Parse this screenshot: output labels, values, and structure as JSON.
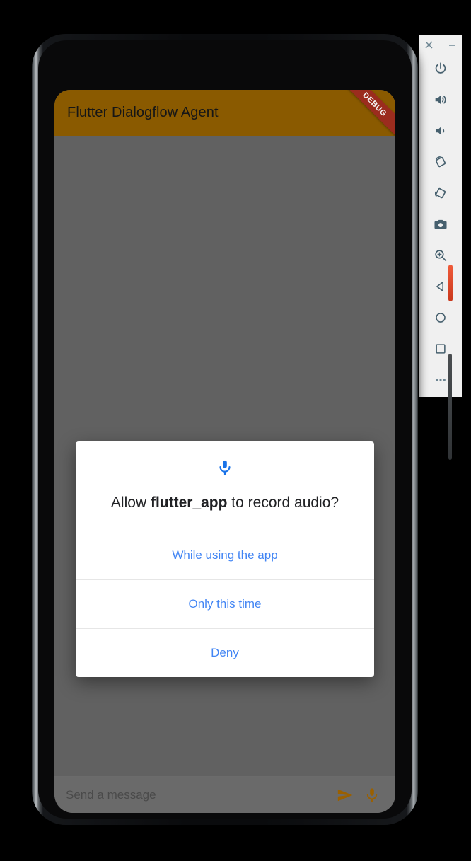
{
  "emulator_toolbar": {
    "window_controls": [
      {
        "name": "close",
        "glyph": "✕"
      },
      {
        "name": "minimize",
        "glyph": "–"
      }
    ],
    "buttons": [
      {
        "name": "power",
        "label": "Power"
      },
      {
        "name": "volume-up",
        "label": "Volume Up"
      },
      {
        "name": "volume-down",
        "label": "Volume Down"
      },
      {
        "name": "rotate-left",
        "label": "Rotate Left"
      },
      {
        "name": "rotate-right",
        "label": "Rotate Right"
      },
      {
        "name": "screenshot",
        "label": "Take Screenshot"
      },
      {
        "name": "zoom",
        "label": "Enter zoom mode"
      },
      {
        "name": "back",
        "label": "Back"
      },
      {
        "name": "home",
        "label": "Home"
      },
      {
        "name": "overview",
        "label": "Overview"
      },
      {
        "name": "more",
        "label": "More"
      }
    ]
  },
  "app": {
    "appbar": {
      "title": "Flutter Dialogflow Agent",
      "debug_banner": "DEBUG",
      "background_color": "#8a5a00",
      "title_color": "#161616",
      "banner_color": "#9b2c1e"
    },
    "input_bar": {
      "placeholder": "Send a message",
      "value": "",
      "send_icon": "send-icon",
      "mic_icon": "microphone-icon",
      "icon_color": "#9a6000"
    },
    "scrim_color": "#616161"
  },
  "permission_dialog": {
    "icon": "microphone-icon",
    "icon_color": "#1a73e8",
    "message_prefix": "Allow ",
    "message_app": "flutter_app",
    "message_suffix": " to record audio?",
    "actions": [
      {
        "label": "While using the app"
      },
      {
        "label": "Only this time"
      },
      {
        "label": "Deny"
      }
    ],
    "action_color": "#4285f4"
  }
}
